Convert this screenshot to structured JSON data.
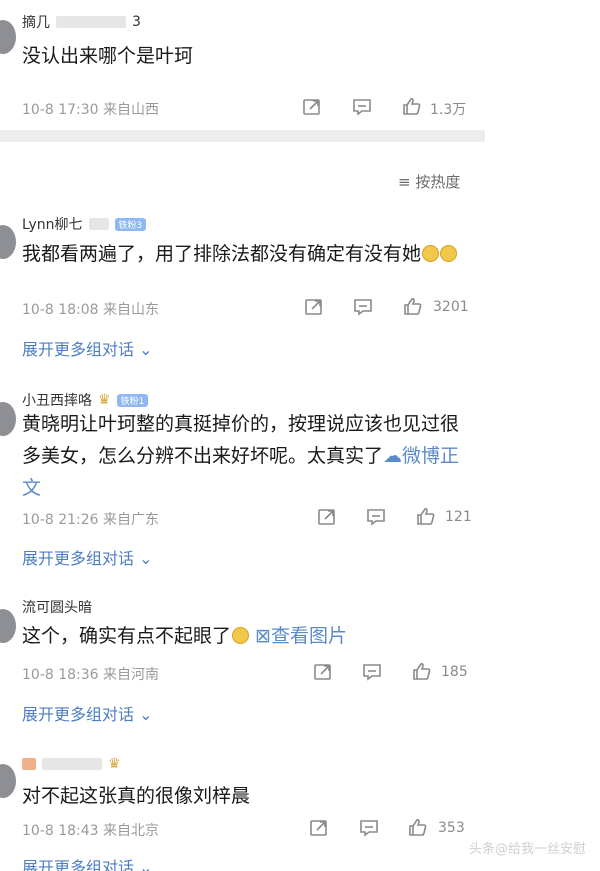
{
  "top_comment": {
    "username": "摘几",
    "username_suffix": "3",
    "text": "没认出来哪个是叶珂",
    "meta": "10-8 17:30 来自山西",
    "likes": "1.3万"
  },
  "sort": {
    "label": "按热度",
    "icon": "sort-lines-icon"
  },
  "comments": [
    {
      "username": "Lynn柳七",
      "badge": "铁粉3",
      "text": "我都看两遍了，用了排除法都没有确定有没有她",
      "meta": "10-8 18:08 来自山东",
      "likes": "3201",
      "expand": "展开更多组对话"
    },
    {
      "username": "小丑西摔咯",
      "badge": "铁粉1",
      "text": "黄晓明让叶珂整的真挺掉价的，按理说应该也见过很多美女，怎么分辨不出来好坏呢。太真实了",
      "link": "微博正文",
      "meta": "10-8 21:26 来自广东",
      "likes": "121",
      "expand": "展开更多组对话"
    },
    {
      "username": "流可圆头暗",
      "text": "这个，确实有点不起眼了",
      "link": "查看图片",
      "meta": "10-8 18:36 来自河南",
      "likes": "185",
      "expand": "展开更多组对话"
    },
    {
      "username": "",
      "text": "对不起这张真的很像刘梓晨",
      "meta": "10-8 18:43 来自北京",
      "likes": "353",
      "expand": "展开更多组对话"
    }
  ],
  "watermark": "头条@给我一丝安慰",
  "colors": {
    "link": "#5b8ac9",
    "expand": "#4d7dc4",
    "badge": "#8fb8f2",
    "meta": "#9a9a9a"
  }
}
